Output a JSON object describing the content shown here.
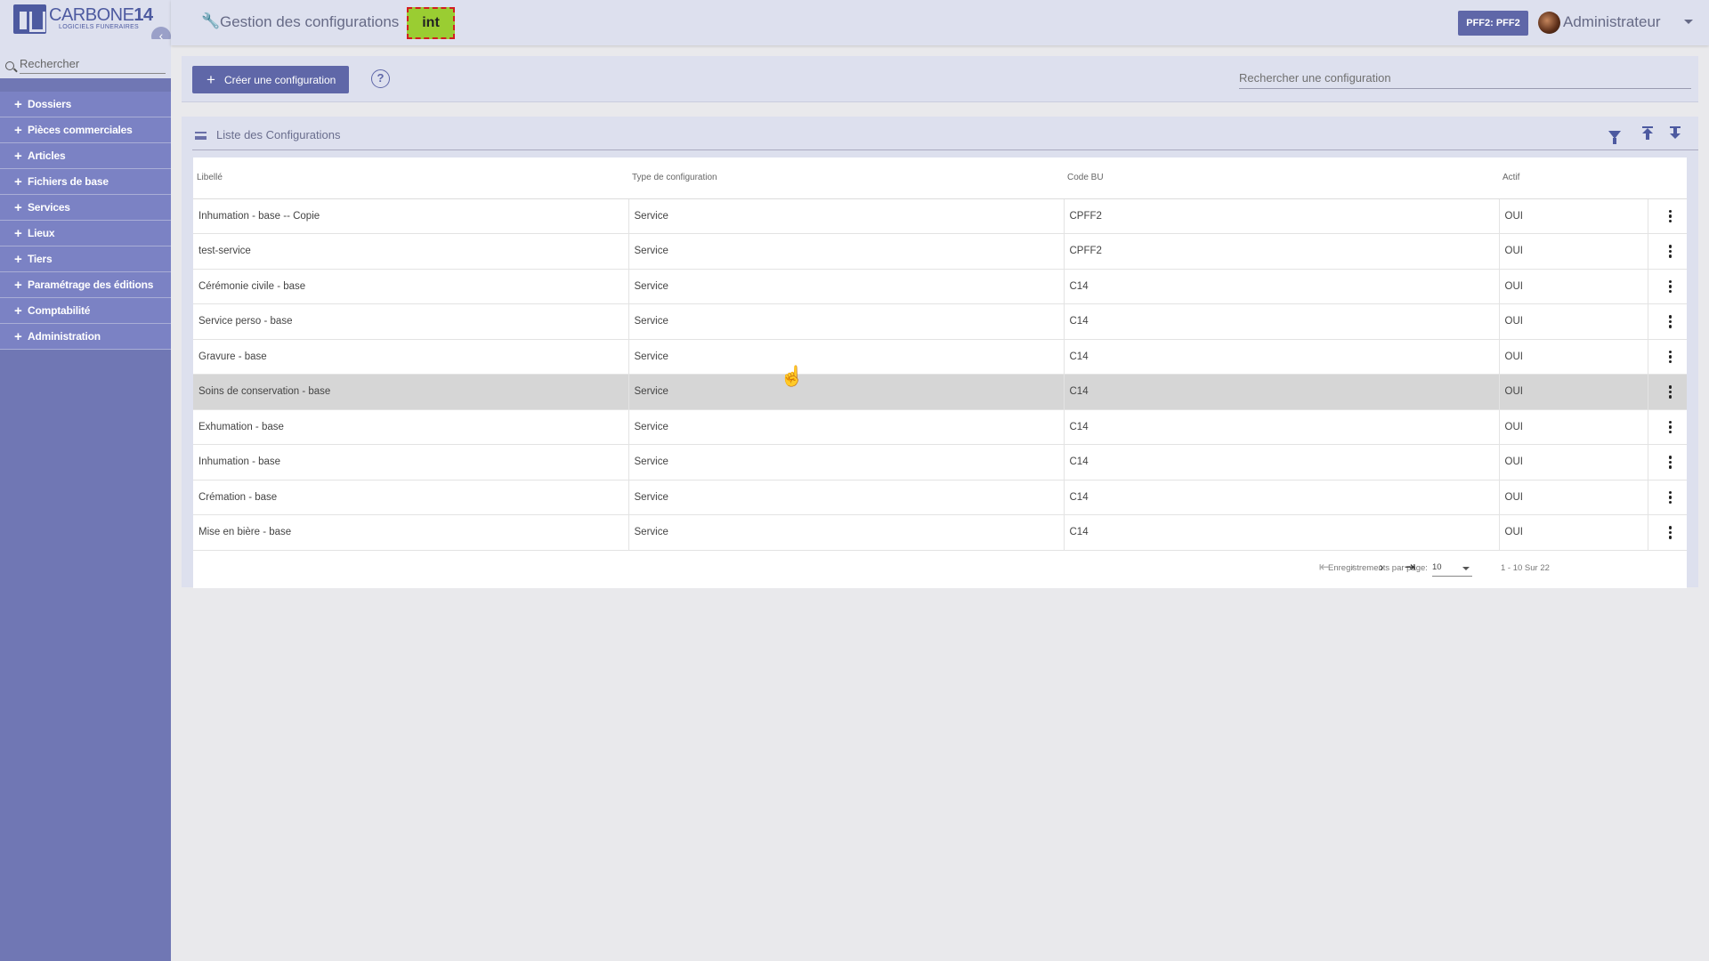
{
  "logo": {
    "brand_main": "CARBONE",
    "brand_num": "14",
    "subtitle": "LOGICIELS FUNERAIRES"
  },
  "sidebar": {
    "search_placeholder": "Rechercher",
    "items": [
      {
        "label": "Dossiers"
      },
      {
        "label": "Pièces commerciales"
      },
      {
        "label": "Articles"
      },
      {
        "label": "Fichiers de base"
      },
      {
        "label": "Services"
      },
      {
        "label": "Lieux"
      },
      {
        "label": "Tiers"
      },
      {
        "label": "Paramétrage des éditions"
      },
      {
        "label": "Comptabilité"
      },
      {
        "label": "Administration"
      }
    ]
  },
  "header": {
    "title": "Gestion des configurations",
    "env_badge": "int",
    "pff_button": "PFF2: PFF2",
    "user": "Administrateur"
  },
  "toolbar": {
    "create_label": "Créer une configuration",
    "help_glyph": "?",
    "search_placeholder": "Rechercher une configuration"
  },
  "panel": {
    "title": "Liste des Configurations",
    "columns": [
      "Libellé",
      "Type de configuration",
      "Code BU",
      "Actif"
    ],
    "rows": [
      {
        "libelle": "Inhumation - base -- Copie",
        "type": "Service",
        "code": "CPFF2",
        "actif": "OUI"
      },
      {
        "libelle": "test-service",
        "type": "Service",
        "code": "CPFF2",
        "actif": "OUI"
      },
      {
        "libelle": "Cérémonie civile - base",
        "type": "Service",
        "code": "C14",
        "actif": "OUI"
      },
      {
        "libelle": "Service perso - base",
        "type": "Service",
        "code": "C14",
        "actif": "OUI"
      },
      {
        "libelle": "Gravure - base",
        "type": "Service",
        "code": "C14",
        "actif": "OUI"
      },
      {
        "libelle": "Soins de conservation - base",
        "type": "Service",
        "code": "C14",
        "actif": "OUI"
      },
      {
        "libelle": "Exhumation - base",
        "type": "Service",
        "code": "C14",
        "actif": "OUI"
      },
      {
        "libelle": "Inhumation - base",
        "type": "Service",
        "code": "C14",
        "actif": "OUI"
      },
      {
        "libelle": "Crémation - base",
        "type": "Service",
        "code": "C14",
        "actif": "OUI"
      },
      {
        "libelle": "Mise en bière - base",
        "type": "Service",
        "code": "C14",
        "actif": "OUI"
      }
    ],
    "highlighted_row": 5
  },
  "paginator": {
    "label": "Enregistrements par page:",
    "page_size": "10",
    "range": "1 - 10 Sur 22"
  },
  "colors": {
    "sidebar": "#7077b4",
    "accent": "#5f67a8",
    "env_badge_bg": "#9acd32",
    "env_badge_border": "#d21f1f"
  }
}
